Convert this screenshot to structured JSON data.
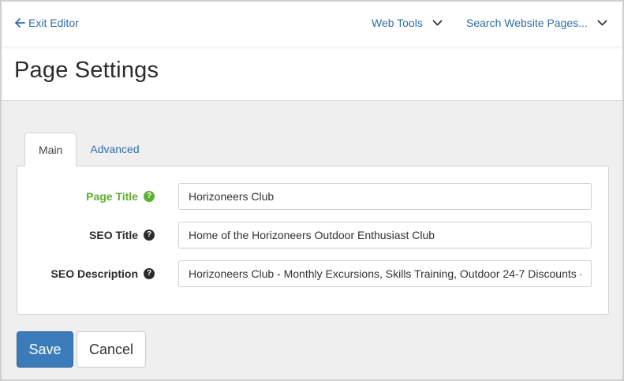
{
  "topbar": {
    "exit_label": "Exit Editor",
    "web_tools_label": "Web Tools",
    "search_label": "Search Website Pages..."
  },
  "header": {
    "title": "Page Settings"
  },
  "tabs": [
    {
      "label": "Main",
      "active": true
    },
    {
      "label": "Advanced",
      "active": false
    }
  ],
  "form": {
    "page_title": {
      "label": "Page Title",
      "value": "Horizoneers Club",
      "help": "?"
    },
    "seo_title": {
      "label": "SEO Title",
      "value": "Home of the Horizoneers Outdoor Enthusiast Club",
      "help": "?"
    },
    "seo_description": {
      "label": "SEO Description",
      "value": "Horizoneers Club - Monthly Excursions, Skills Training, Outdoor 24-7 Discounts - Join Today",
      "help": "?"
    }
  },
  "actions": {
    "save_label": "Save",
    "cancel_label": "Cancel"
  },
  "colors": {
    "link": "#2f6fa7",
    "primary": "#3c7bba",
    "required_label": "#5cb030",
    "background": "#efefef"
  },
  "icons": [
    "arrow-left-icon",
    "chevron-down-icon",
    "help-icon"
  ]
}
